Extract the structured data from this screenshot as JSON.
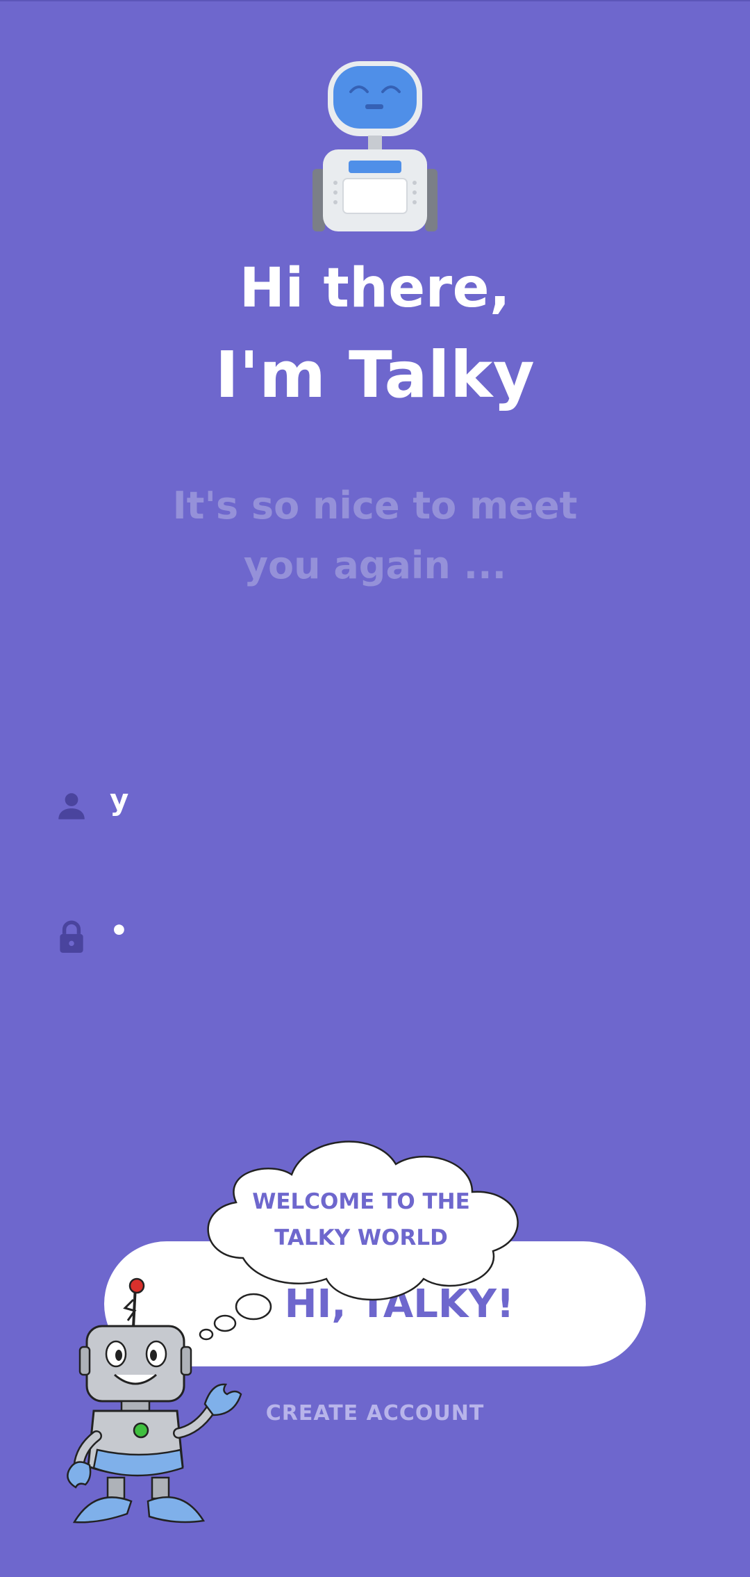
{
  "header": {
    "title_line1": "Hi there,",
    "title_line2": "I'm Talky",
    "subtitle": "It's so nice to meet you again ..."
  },
  "form": {
    "username": {
      "icon": "person-icon",
      "value": "y"
    },
    "password": {
      "icon": "lock-icon",
      "value": "•"
    }
  },
  "actions": {
    "login_label": "HI, TALKY!",
    "create_account_label": "CREATE ACCOUNT"
  },
  "bubble": {
    "line1": "WELCOME TO THE",
    "line2": "TALKY WORLD"
  },
  "colors": {
    "background": "#6e67cd",
    "accent": "#6e67cd",
    "muted_text": "#9591d9",
    "white": "#ffffff"
  }
}
